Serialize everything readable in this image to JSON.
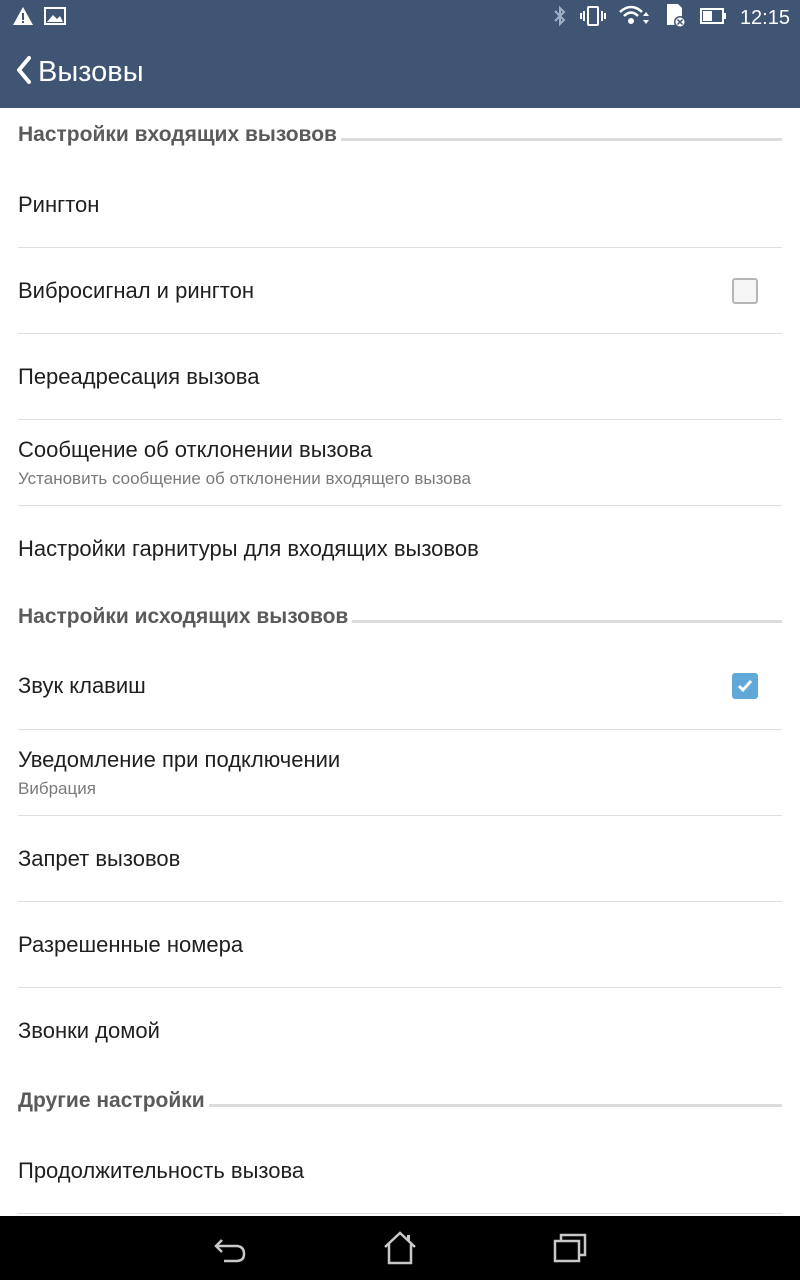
{
  "status_bar": {
    "time": "12:15",
    "icons": [
      "warning-icon",
      "image-icon",
      "bluetooth-icon",
      "vibrate-icon",
      "wifi-icon",
      "sd-card-icon",
      "battery-icon"
    ]
  },
  "action_bar": {
    "title": "Вызовы",
    "back_icon": "chevron-left-icon"
  },
  "sections": {
    "incoming": {
      "title": "Настройки входящих вызовов",
      "items": [
        {
          "primary": "Рингтон"
        },
        {
          "primary": "Вибросигнал и рингтон",
          "checkbox": false
        },
        {
          "primary": "Переадресация вызова"
        },
        {
          "primary": "Сообщение об отклонении вызова",
          "secondary": "Установить сообщение об отклонении входящего вызова"
        },
        {
          "primary": "Настройки гарнитуры для входящих вызовов"
        }
      ]
    },
    "outgoing": {
      "title": "Настройки исходящих вызовов",
      "items": [
        {
          "primary": "Звук клавиш",
          "checkbox": true
        },
        {
          "primary": "Уведомление при подключении",
          "secondary": "Вибрация"
        },
        {
          "primary": "Запрет вызовов"
        },
        {
          "primary": "Разрешенные номера"
        },
        {
          "primary": "Звонки домой"
        }
      ]
    },
    "other": {
      "title": "Другие настройки",
      "items": [
        {
          "primary": "Продолжительность вызова"
        }
      ]
    }
  },
  "colors": {
    "bar": "#3f5573",
    "accent": "#5fa8d8",
    "nav": "#000000"
  },
  "nav_bar": {
    "icons": [
      "back-icon",
      "home-icon",
      "recent-apps-icon"
    ]
  }
}
